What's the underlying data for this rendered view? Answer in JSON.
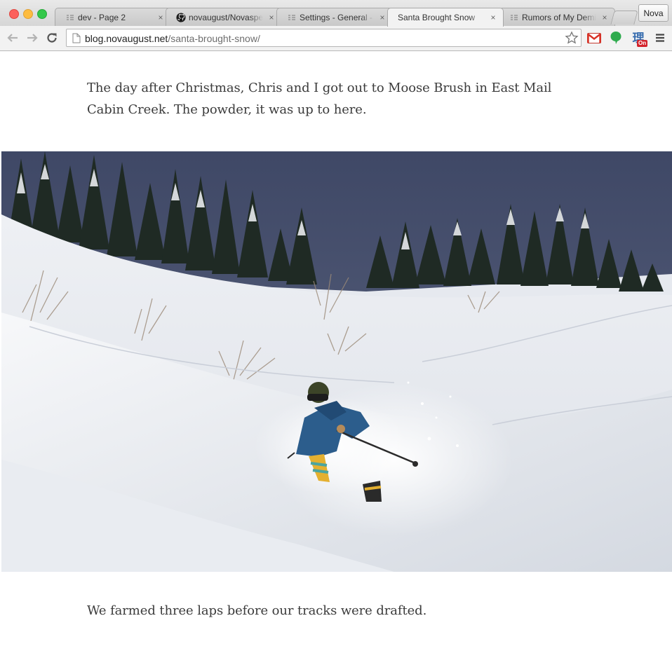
{
  "browser": {
    "tabs": [
      {
        "title": "dev - Page 2",
        "icon": "page-icon",
        "active": false
      },
      {
        "title": "novaugust/Novaspe",
        "icon": "github-icon",
        "active": false
      },
      {
        "title": "Settings - General -",
        "icon": "page-icon",
        "active": false
      },
      {
        "title": "Santa Brought Snow",
        "icon": "page-icon",
        "active": true
      },
      {
        "title": "Rumors of My Demi",
        "icon": "page-icon",
        "active": false
      }
    ],
    "close_glyph": "×",
    "profile_name": "Nova",
    "url": {
      "domain": "blog.novaugust.net",
      "path": "/santa-brought-snow/"
    },
    "extensions": [
      "gmail-icon",
      "speech-bubble-icon",
      "dictionary-icon"
    ],
    "dictionary_glyph": "理",
    "dictionary_badge": "On"
  },
  "article": {
    "paragraph_1": "The day after Christmas, Chris and I got out to Moose Brush in East Mail Cabin Creek. The powder, it was up to here.",
    "photo_icon": "skier-in-powder-photo",
    "paragraph_2": "We farmed three laps before our tracks were drafted."
  },
  "colors": {
    "sky": "#4a5470",
    "snow": "#f2f4f7",
    "text": "#3b3b3b"
  }
}
